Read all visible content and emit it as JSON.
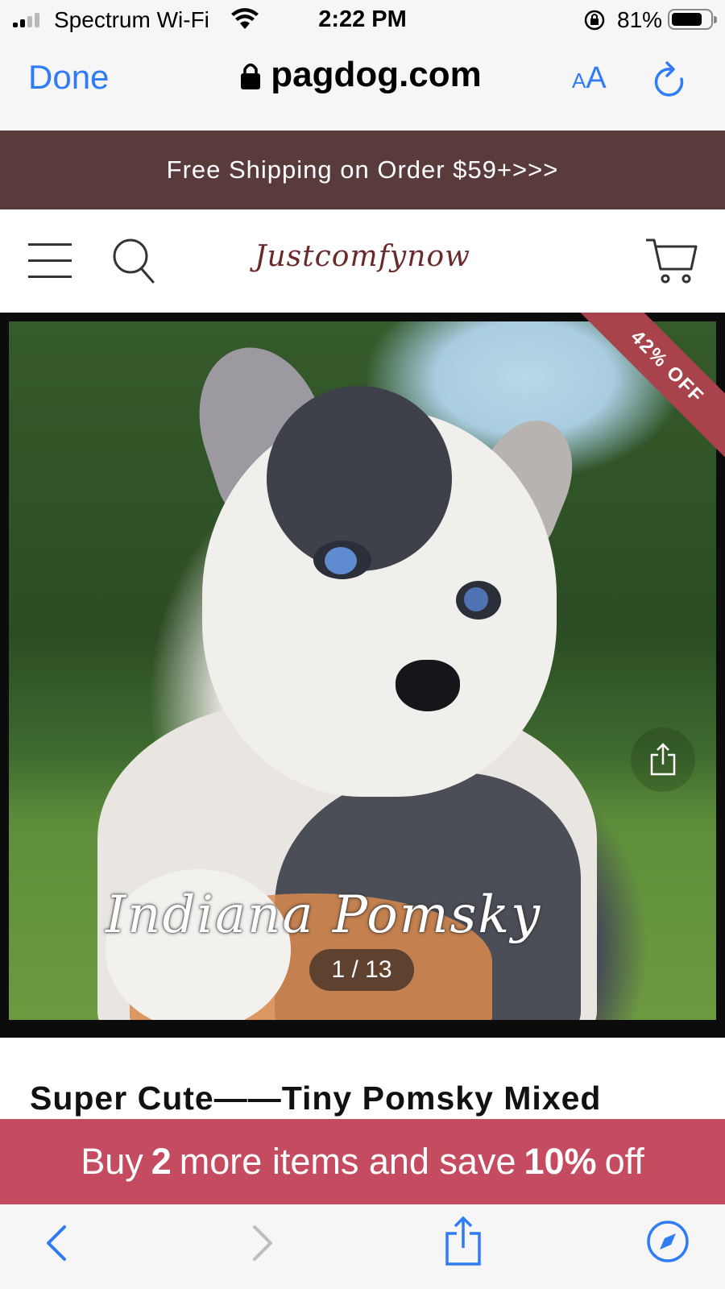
{
  "status": {
    "carrier": "Spectrum Wi-Fi",
    "time": "2:22 PM",
    "battery_pct": "81%",
    "battery_level": 0.81
  },
  "browser": {
    "done_label": "Done",
    "url": "pagdog.com",
    "text_size_small": "A",
    "text_size_large": "A"
  },
  "promo": {
    "text": "Free Shipping on Order $59+>>>"
  },
  "site": {
    "logo_text": "Justcomfynow"
  },
  "product": {
    "discount_badge": "42% OFF",
    "watermark": "Indiana Pomsky",
    "image_counter": "1 / 13",
    "title": "Super Cute——Tiny Pomsky Mixed"
  },
  "offer": {
    "prefix": "Buy",
    "count": "2",
    "middle": "more items and save",
    "discount": "10%",
    "suffix": "off"
  },
  "colors": {
    "accent": "#2f7cf6",
    "promo_bg": "#5a3b3b",
    "offer_bg": "#c54b60",
    "badge_bg": "#a8434c"
  }
}
